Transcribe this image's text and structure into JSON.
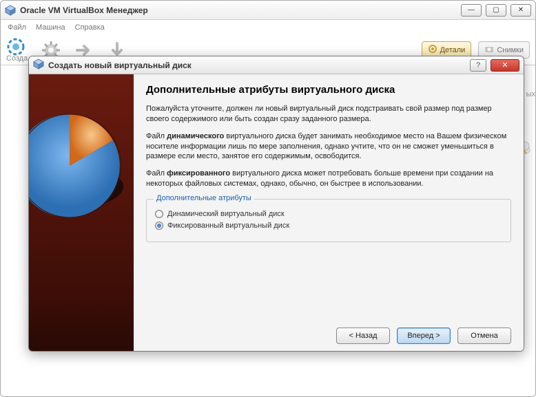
{
  "main_window": {
    "title": "Oracle VM VirtualBox Менеджер",
    "menu": {
      "file": "Файл",
      "machine": "Машина",
      "help": "Справка"
    },
    "toolbar": {
      "create_label": "Созда",
      "details": "Детали",
      "snapshots": "Снимки"
    },
    "bg_fragment": "ых"
  },
  "dialog": {
    "title": "Создать новый виртуальный диск",
    "heading": "Дополнительные атрибуты виртуального диска",
    "p1": "Пожалуйста уточните, должен ли новый виртуальный диск подстраивать свой размер под размер своего содержимого или быть создан сразу заданного размера.",
    "p2_prefix": "Файл ",
    "p2_bold": "динамического",
    "p2_rest": " виртуального диска будет занимать необходимое место на Вашем физическом носителе информации лишь по мере заполнения, однако учтите, что он не сможет уменьшиться в размере если место, занятое его содержимым, освободится.",
    "p3_prefix": "Файл ",
    "p3_bold": "фиксированного",
    "p3_rest": " виртуального диска может потребовать больше времени при создании на некоторых файловых системах, однако, обычно, он быстрее в использовании.",
    "groupbox_legend": "Дополнительные атрибуты",
    "option_dynamic": "Динамический виртуальный диск",
    "option_fixed": "Фиксированный виртуальный диск",
    "selected": "fixed",
    "buttons": {
      "back": "< Назад",
      "next": "Вперед >",
      "cancel": "Отмена"
    }
  }
}
